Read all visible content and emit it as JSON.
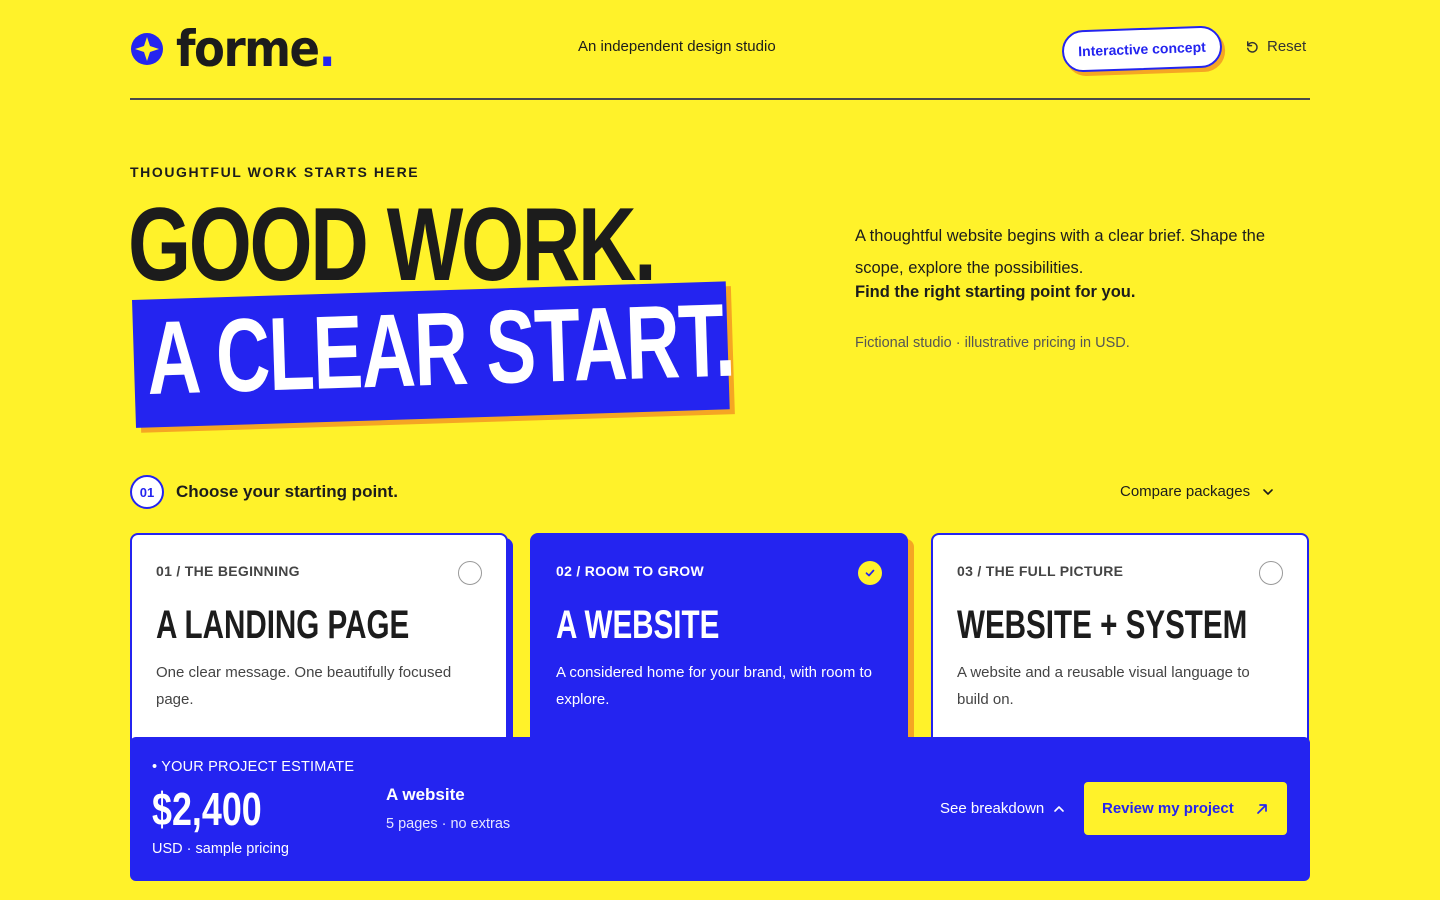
{
  "header": {
    "brand": "forme",
    "brand_dot": ".",
    "tagline": "An independent design studio",
    "concept_label": "Interactive concept",
    "reset_label": "Reset"
  },
  "hero": {
    "eyebrow": "THOUGHTFUL WORK STARTS HERE",
    "line1": "GOOD WORK.",
    "line2": "A CLEAR START.",
    "description": "A thoughtful website begins with a clear brief. Shape the scope, explore the possibilities.",
    "description_strong": "Find the right starting point for you.",
    "note": "Fictional studio · illustrative pricing in USD."
  },
  "step": {
    "number": "01",
    "title": "Choose your starting point.",
    "compare_label": "Compare packages"
  },
  "cards": [
    {
      "kicker": "01 / THE BEGINNING",
      "title": "A LANDING PAGE",
      "description": "One clear message. One beautifully focused page.",
      "selected": false
    },
    {
      "kicker": "02 / ROOM TO GROW",
      "title": "A WEBSITE",
      "description": "A considered home for your brand, with room to explore.",
      "selected": true
    },
    {
      "kicker": "03 / THE FULL PICTURE",
      "title": "WEBSITE + SYSTEM",
      "description": "A website and a reusable visual language to build on.",
      "selected": false
    }
  ],
  "estimate": {
    "kicker": "• YOUR PROJECT ESTIMATE",
    "amount": "$2,400",
    "unit": "USD · sample pricing",
    "package": "A website",
    "meta": "5 pages · no extras",
    "breakdown_label": "See breakdown",
    "review_label": "Review my project"
  },
  "colors": {
    "background": "#FFF22A",
    "accent_blue": "#2424F0",
    "accent_orange": "#F5A623",
    "ink": "#1C1C1C"
  },
  "icons": {
    "logo": "sparkle-star-icon",
    "reset": "undo-icon",
    "compare": "chevron-down-icon",
    "selected": "check-icon",
    "breakdown": "chevron-up-icon",
    "review": "arrow-up-right-icon"
  }
}
